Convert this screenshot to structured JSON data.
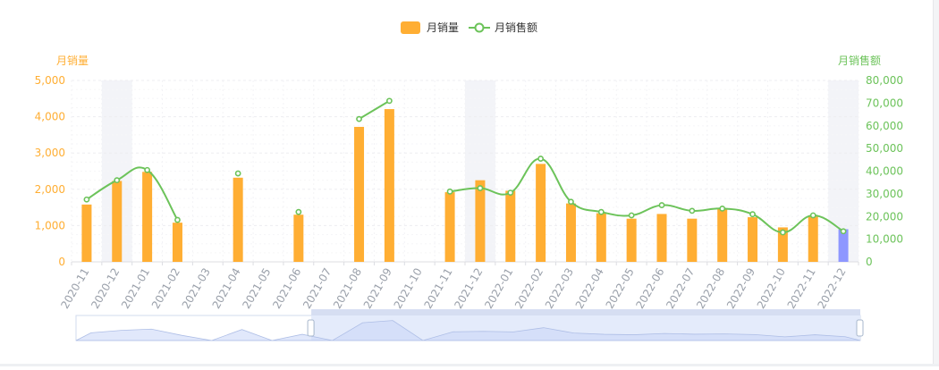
{
  "chart_data": {
    "type": "bar",
    "categories": [
      "2020-11",
      "2020-12",
      "2021-01",
      "2021-02",
      "2021-03",
      "2021-04",
      "2021-05",
      "2021-06",
      "2021-07",
      "2021-08",
      "2021-09",
      "2021-10",
      "2021-11",
      "2021-12",
      "2022-01",
      "2022-02",
      "2022-03",
      "2022-04",
      "2022-05",
      "2022-06",
      "2022-07",
      "2022-08",
      "2022-09",
      "2022-10",
      "2022-11",
      "2022-12"
    ],
    "series": [
      {
        "name": "月销量",
        "kind": "bar",
        "axis": "left",
        "color": "#FFAE33",
        "highlight_color": "#8E97FF",
        "values": [
          1580,
          2230,
          2480,
          1080,
          null,
          2320,
          null,
          1300,
          null,
          3720,
          4210,
          null,
          1920,
          2250,
          1960,
          2700,
          1610,
          1340,
          1190,
          1320,
          1190,
          1470,
          1230,
          950,
          1250,
          900
        ]
      },
      {
        "name": "月销售额",
        "kind": "line",
        "axis": "right",
        "color": "#6CC35A",
        "values": [
          27500,
          36000,
          40500,
          18500,
          null,
          39000,
          null,
          22000,
          null,
          63000,
          71000,
          null,
          31000,
          32500,
          30500,
          45500,
          26500,
          22000,
          20500,
          25000,
          22500,
          23500,
          21000,
          13000,
          20500,
          13500
        ]
      }
    ],
    "highlight_category": "2022-12",
    "shaded_categories": [
      "2020-12",
      "2021-12",
      "2022-12"
    ],
    "y_left": {
      "label": "月销量",
      "min": 0,
      "max": 5000,
      "ticks": [
        "0",
        "1,000",
        "2,000",
        "3,000",
        "4,000",
        "5,000"
      ]
    },
    "y_right": {
      "label": "月销售额",
      "min": 0,
      "max": 80000,
      "ticks": [
        "0",
        "10,000",
        "20,000",
        "30,000",
        "40,000",
        "50,000",
        "60,000",
        "70,000",
        "80,000"
      ]
    },
    "legend": {
      "position": "top-center",
      "items": [
        "月销量",
        "月销售额"
      ]
    },
    "grid": true,
    "datazoom": {
      "start_fraction": 0.3,
      "end_fraction": 1.0
    }
  },
  "colors": {
    "bar": "#FFAE33",
    "line": "#6CC35A",
    "left_axis": "#FFAE33",
    "right_axis": "#6CC35A",
    "x_label": "#9aa0aa",
    "zoom_fill": "#c9d6f7"
  }
}
